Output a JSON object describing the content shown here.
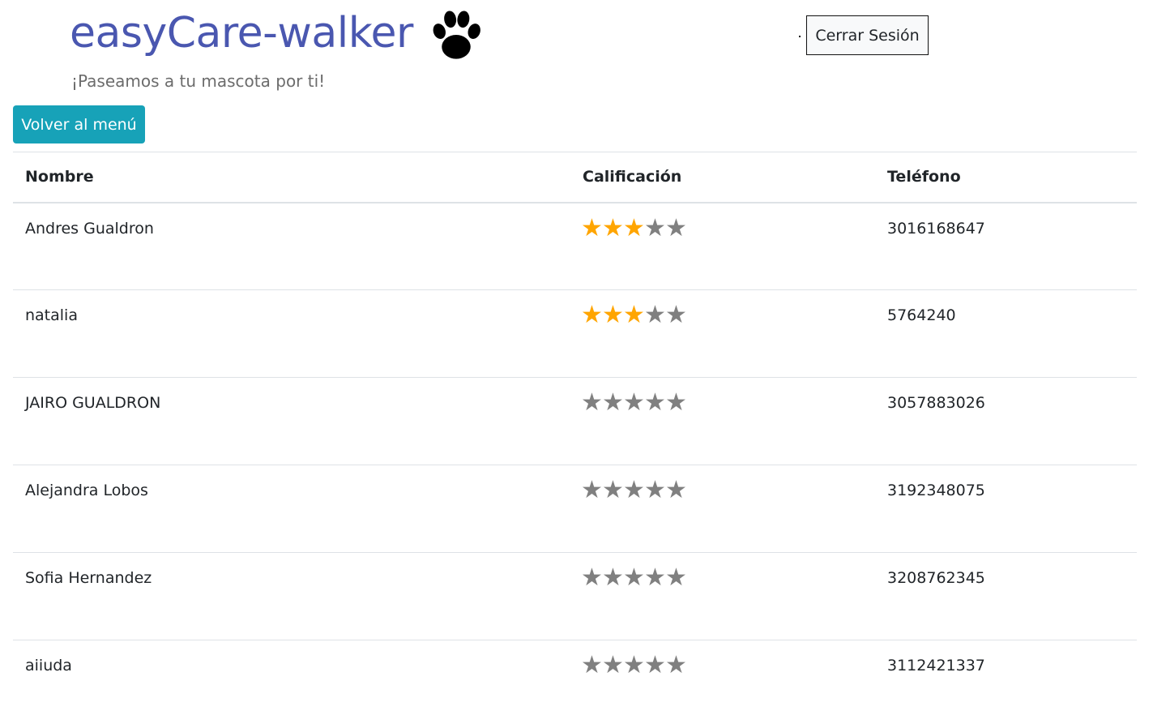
{
  "header": {
    "brand_title": "easyCare-walker",
    "tagline": "¡Paseamos a tu mascota por ti!",
    "logout_label": "Cerrar Sesión",
    "logo_icon": "paw-icon"
  },
  "back_button": {
    "label": "Volver al menú",
    "color": "#17a2b8"
  },
  "table": {
    "columns": [
      "Nombre",
      "Calificación",
      "Teléfono"
    ],
    "star_colors": {
      "filled": "#ffa500",
      "empty": "#808080"
    },
    "rows": [
      {
        "name": "Andres Gualdron",
        "rating": 3,
        "phone": "3016168647"
      },
      {
        "name": "natalia",
        "rating": 3,
        "phone": "5764240"
      },
      {
        "name": "JAIRO GUALDRON",
        "rating": 0,
        "phone": "3057883026"
      },
      {
        "name": "Alejandra Lobos",
        "rating": 0,
        "phone": "3192348075"
      },
      {
        "name": "Sofia Hernandez",
        "rating": 0,
        "phone": "3208762345"
      },
      {
        "name": "aiiuda",
        "rating": 0,
        "phone": "3112421337"
      }
    ],
    "max_rating": 5
  }
}
